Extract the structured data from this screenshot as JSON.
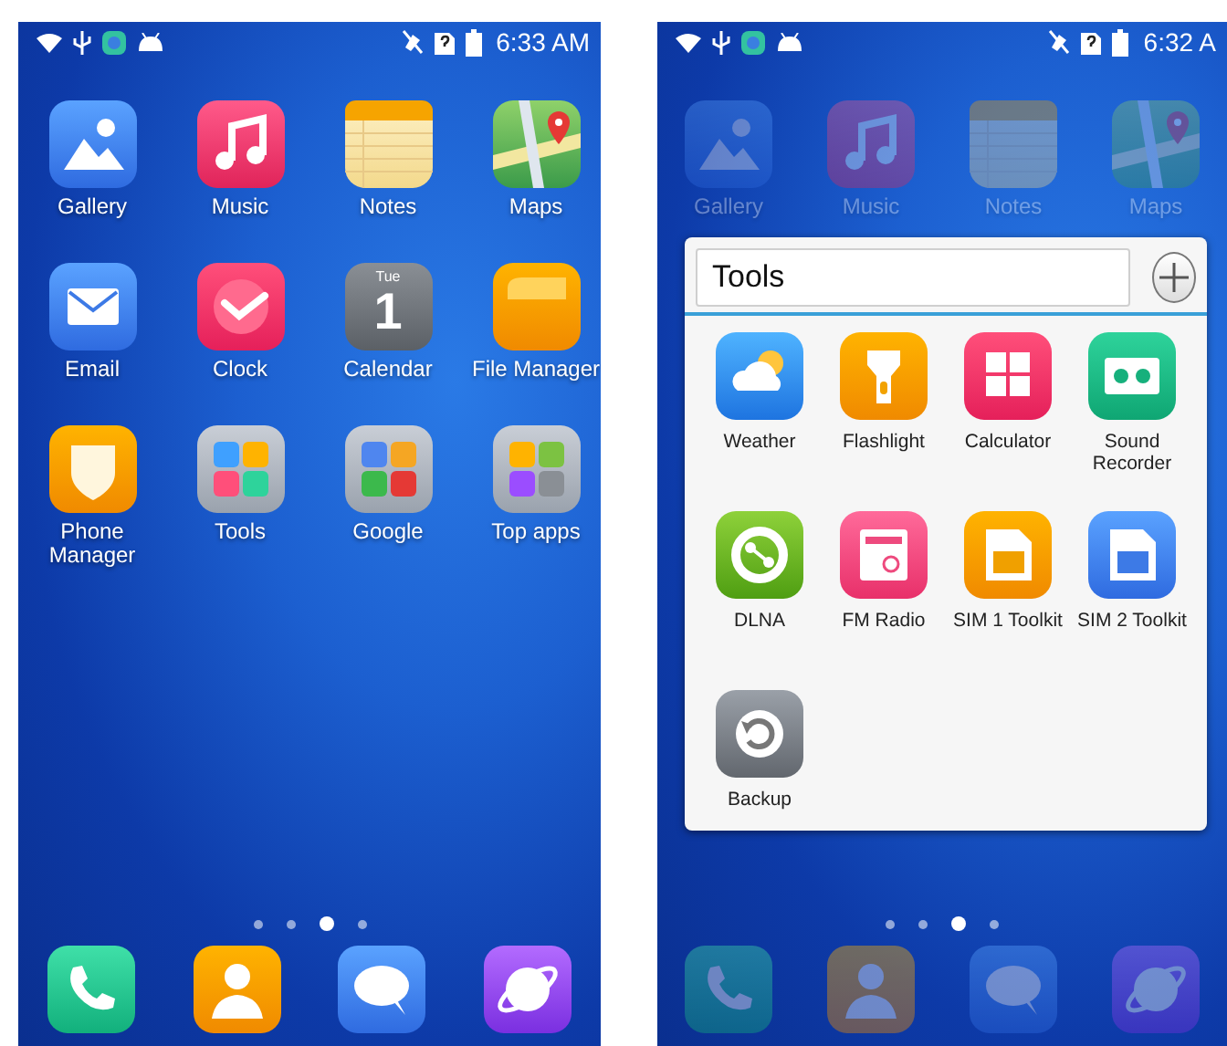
{
  "screens": [
    {
      "status_bar": {
        "time": "6:33 AM"
      },
      "apps": [
        {
          "label": "Gallery"
        },
        {
          "label": "Music"
        },
        {
          "label": "Notes"
        },
        {
          "label": "Maps"
        },
        {
          "label": "Email"
        },
        {
          "label": "Clock"
        },
        {
          "label": "Calendar",
          "icon_day": "Tue",
          "icon_date": "1"
        },
        {
          "label": "File Manager"
        },
        {
          "label": "Phone Manager"
        },
        {
          "label": "Tools"
        },
        {
          "label": "Google"
        },
        {
          "label": "Top apps"
        }
      ],
      "page_indicator": [
        {
          "selected": false
        },
        {
          "selected": false
        },
        {
          "selected": true
        },
        {
          "selected": false
        }
      ]
    },
    {
      "status_bar": {
        "time": "6:32 A"
      },
      "apps": [
        {
          "label": "Gallery"
        },
        {
          "label": "Music"
        },
        {
          "label": "Notes"
        },
        {
          "label": "Maps"
        }
      ],
      "folder": {
        "name": "Tools",
        "apps": [
          {
            "label": "Weather"
          },
          {
            "label": "Flashlight"
          },
          {
            "label": "Calculator"
          },
          {
            "label": "Sound Recorder"
          },
          {
            "label": "DLNA"
          },
          {
            "label": "FM Radio"
          },
          {
            "label": "SIM 1 Toolkit"
          },
          {
            "label": "SIM 2 Toolkit"
          },
          {
            "label": "Backup"
          }
        ]
      },
      "page_indicator": [
        {
          "selected": false
        },
        {
          "selected": false
        },
        {
          "selected": true
        },
        {
          "selected": false
        }
      ]
    }
  ]
}
